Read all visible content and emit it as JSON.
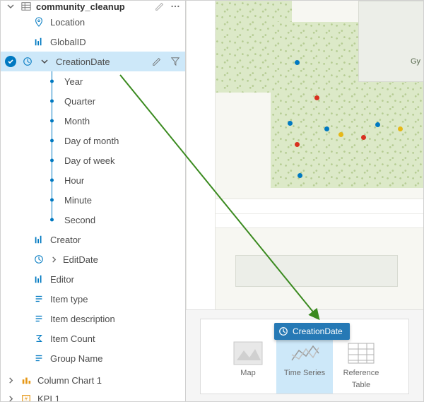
{
  "layer": {
    "name": "community_cleanup"
  },
  "fields": {
    "location": "Location",
    "globalid": "GlobalID",
    "creationdate": "CreationDate",
    "creator": "Creator",
    "editdate": "EditDate",
    "editor": "Editor",
    "itemtype": "Item type",
    "itemdesc": "Item description",
    "itemcount": "Item Count",
    "groupname": "Group Name"
  },
  "date_parts": {
    "year": "Year",
    "quarter": "Quarter",
    "month": "Month",
    "dayofmonth": "Day of month",
    "dayofweek": "Day of week",
    "hour": "Hour",
    "minute": "Minute",
    "second": "Second"
  },
  "bottom": {
    "chart1": "Column Chart 1",
    "kpi1": "KPI 1"
  },
  "map": {
    "label_gy": "Gy"
  },
  "drop": {
    "map": "Map",
    "timeseries_line1": "Time Series",
    "reftable_line1": "Reference",
    "reftable_line2": "Table"
  },
  "drag_chip": "CreationDate"
}
